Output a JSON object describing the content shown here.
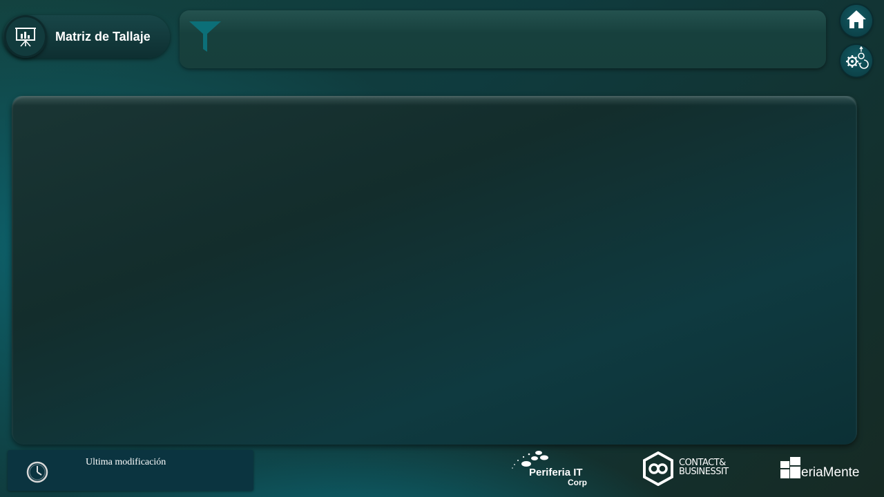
{
  "header": {
    "title": "Matriz de Tallaje",
    "title_icon": "presentation-chart-icon"
  },
  "filter_bar": {
    "icon": "filter-funnel-icon"
  },
  "nav": {
    "home_icon": "home-icon",
    "settings_icon": "settings-gears-refresh-icon"
  },
  "footer": {
    "last_modified_label": "Ultima modificación",
    "clock_icon": "clock-icon",
    "logos": {
      "periferia_name": "Periferia IT",
      "periferia_sub": "Corp",
      "contact_line1": "CONTACT&",
      "contact_line2": "BUSINESSIT",
      "feria_text": "eriaMente"
    }
  },
  "colors": {
    "accent_teal": "#0d5f69",
    "panel_dark": "#132d2c",
    "text": "#ffffff"
  }
}
